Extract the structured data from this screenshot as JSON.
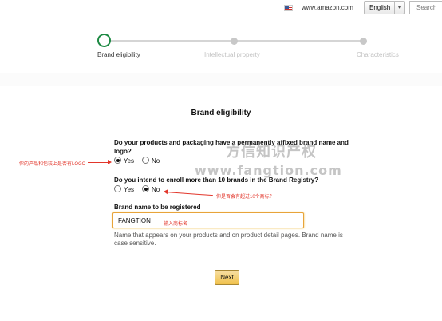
{
  "header": {
    "site": "www.amazon.com",
    "language": "English",
    "search_placeholder": "Search"
  },
  "stepper": {
    "steps": [
      {
        "label": "Brand eligibility",
        "active": true
      },
      {
        "label": "Intellectual property",
        "active": false
      },
      {
        "label": "Characteristics",
        "active": false
      }
    ]
  },
  "form": {
    "title": "Brand eligibility",
    "q1": {
      "line1": "Do your products and packaging have a permanently affixed brand name and",
      "line2": "logo?",
      "yes": "Yes",
      "no": "No",
      "selected": "Yes"
    },
    "q2": {
      "text": "Do you intend to enroll more than 10 brands in the Brand Registry?",
      "yes": "Yes",
      "no": "No",
      "selected": "No"
    },
    "brand_name": {
      "label": "Brand name to be registered",
      "value": "FANGTION",
      "hint_line1": "Name that appears on your products and on product detail pages. Brand name is",
      "hint_line2": "case sensitive."
    },
    "next_label": "Next"
  },
  "annotations": {
    "logo_note": "你的产品和包装上是否有LOGO",
    "brands_note": "你是否会有超过10个商标？",
    "input_note": "输入商标名"
  },
  "watermark": {
    "line1": "方信知识产权",
    "line2": "www.fangtion.com"
  },
  "colors": {
    "active_step": "#1e8a44",
    "annotation": "#e2362b",
    "button": "#f0c14b"
  }
}
